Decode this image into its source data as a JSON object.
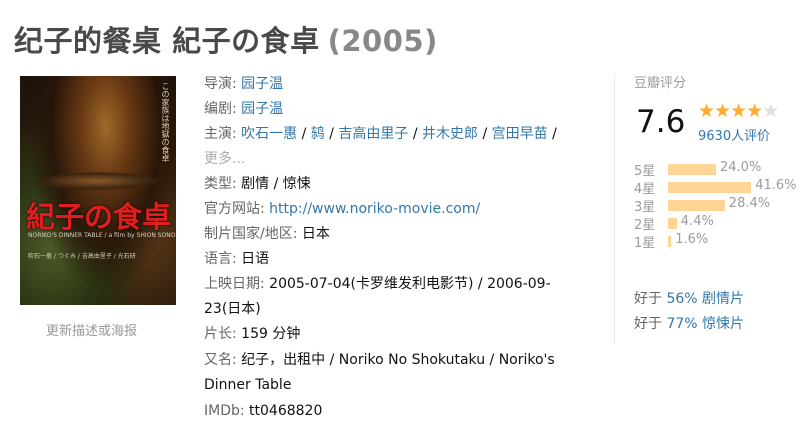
{
  "title": {
    "main": "纪子的餐桌 紀子の食卓",
    "year": "(2005)"
  },
  "poster": {
    "title_text": "紀子の食卓",
    "vertical_text": "この家族は地獄の食卓",
    "sub_text": "NORIKO'S DINNER TABLE / a film by SHION SONO",
    "cast_text": "吹石一恵 / つぐみ / 吉高由里子 / 光石研",
    "update_link": "更新描述或海报"
  },
  "info": {
    "director": {
      "label": "导演",
      "value": "园子温"
    },
    "writer": {
      "label": "编剧",
      "value": "园子温"
    },
    "cast": {
      "label": "主演",
      "names": [
        "吹石一惠",
        "鸫",
        "吉高由里子",
        "井木史郎",
        "宫田早苗"
      ],
      "more": "更多..."
    },
    "genre": {
      "label": "类型",
      "values": [
        "剧情",
        "惊悚"
      ]
    },
    "website": {
      "label": "官方网站",
      "value": "http://www.noriko-movie.com/"
    },
    "country": {
      "label": "制片国家/地区",
      "value": "日本"
    },
    "language": {
      "label": "语言",
      "value": "日语"
    },
    "release": {
      "label": "上映日期",
      "line1": "2005-07-04(卡罗维发利电影节) / 2006-09-",
      "line2": "23(日本)"
    },
    "runtime": {
      "label": "片长",
      "value": "159 分钟"
    },
    "aka": {
      "label": "又名",
      "line1": "纪子，出租中 / Noriko No Shokutaku / Noriko's",
      "line2": "Dinner Table"
    },
    "imdb": {
      "label": "IMDb",
      "value": "tt0468820"
    }
  },
  "rating": {
    "label": "豆瓣评分",
    "score": "7.6",
    "stars_filled": 4,
    "stars_total": 5,
    "votes": "9630人评价",
    "distribution": [
      {
        "label": "5星",
        "percent": "24.0%",
        "value": 24.0
      },
      {
        "label": "4星",
        "percent": "41.6%",
        "value": 41.6
      },
      {
        "label": "3星",
        "percent": "28.4%",
        "value": 28.4
      },
      {
        "label": "2星",
        "percent": "4.4%",
        "value": 4.4
      },
      {
        "label": "1星",
        "percent": "1.6%",
        "value": 1.6
      }
    ],
    "better_than": [
      {
        "prefix": "好于 ",
        "link": "56% 剧情片"
      },
      {
        "prefix": "好于 ",
        "link": "77% 惊悚片"
      }
    ]
  },
  "colors": {
    "link": "#3377aa",
    "star": "#ffac2d",
    "bar": "#ffd596",
    "poster_title": "#e01e1e"
  }
}
